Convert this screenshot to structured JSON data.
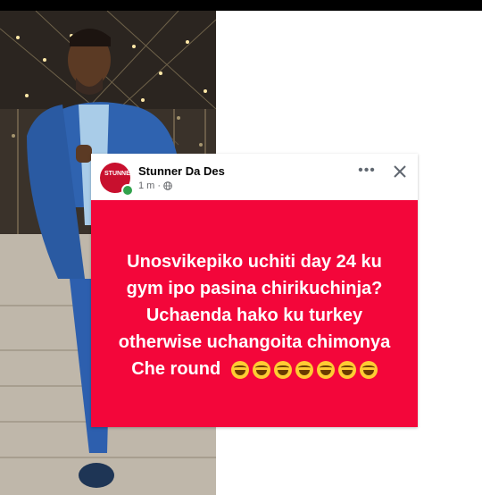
{
  "post": {
    "author": "Stunner Da Des",
    "time": "1 m",
    "separator": "·",
    "body_text": "Unosvikepiko uchiti day 24 ku gym ipo pasina chirikuchinja? Uchaenda hako ku turkey otherwise uchangoita chimonya Che round",
    "emoji": [
      "rolling-on-floor-laughing",
      "rolling-on-floor-laughing",
      "rolling-on-floor-laughing",
      "rolling-on-floor-laughing",
      "rolling-on-floor-laughing",
      "rolling-on-floor-laughing",
      "rolling-on-floor-laughing"
    ],
    "background_color": "#f3063a",
    "text_color": "#ffffff"
  },
  "controls": {
    "more_label": "•••",
    "close_icon": "close-icon"
  },
  "avatar": {
    "initials": "STUNNER"
  },
  "status": {
    "online_color": "#31a24c"
  }
}
